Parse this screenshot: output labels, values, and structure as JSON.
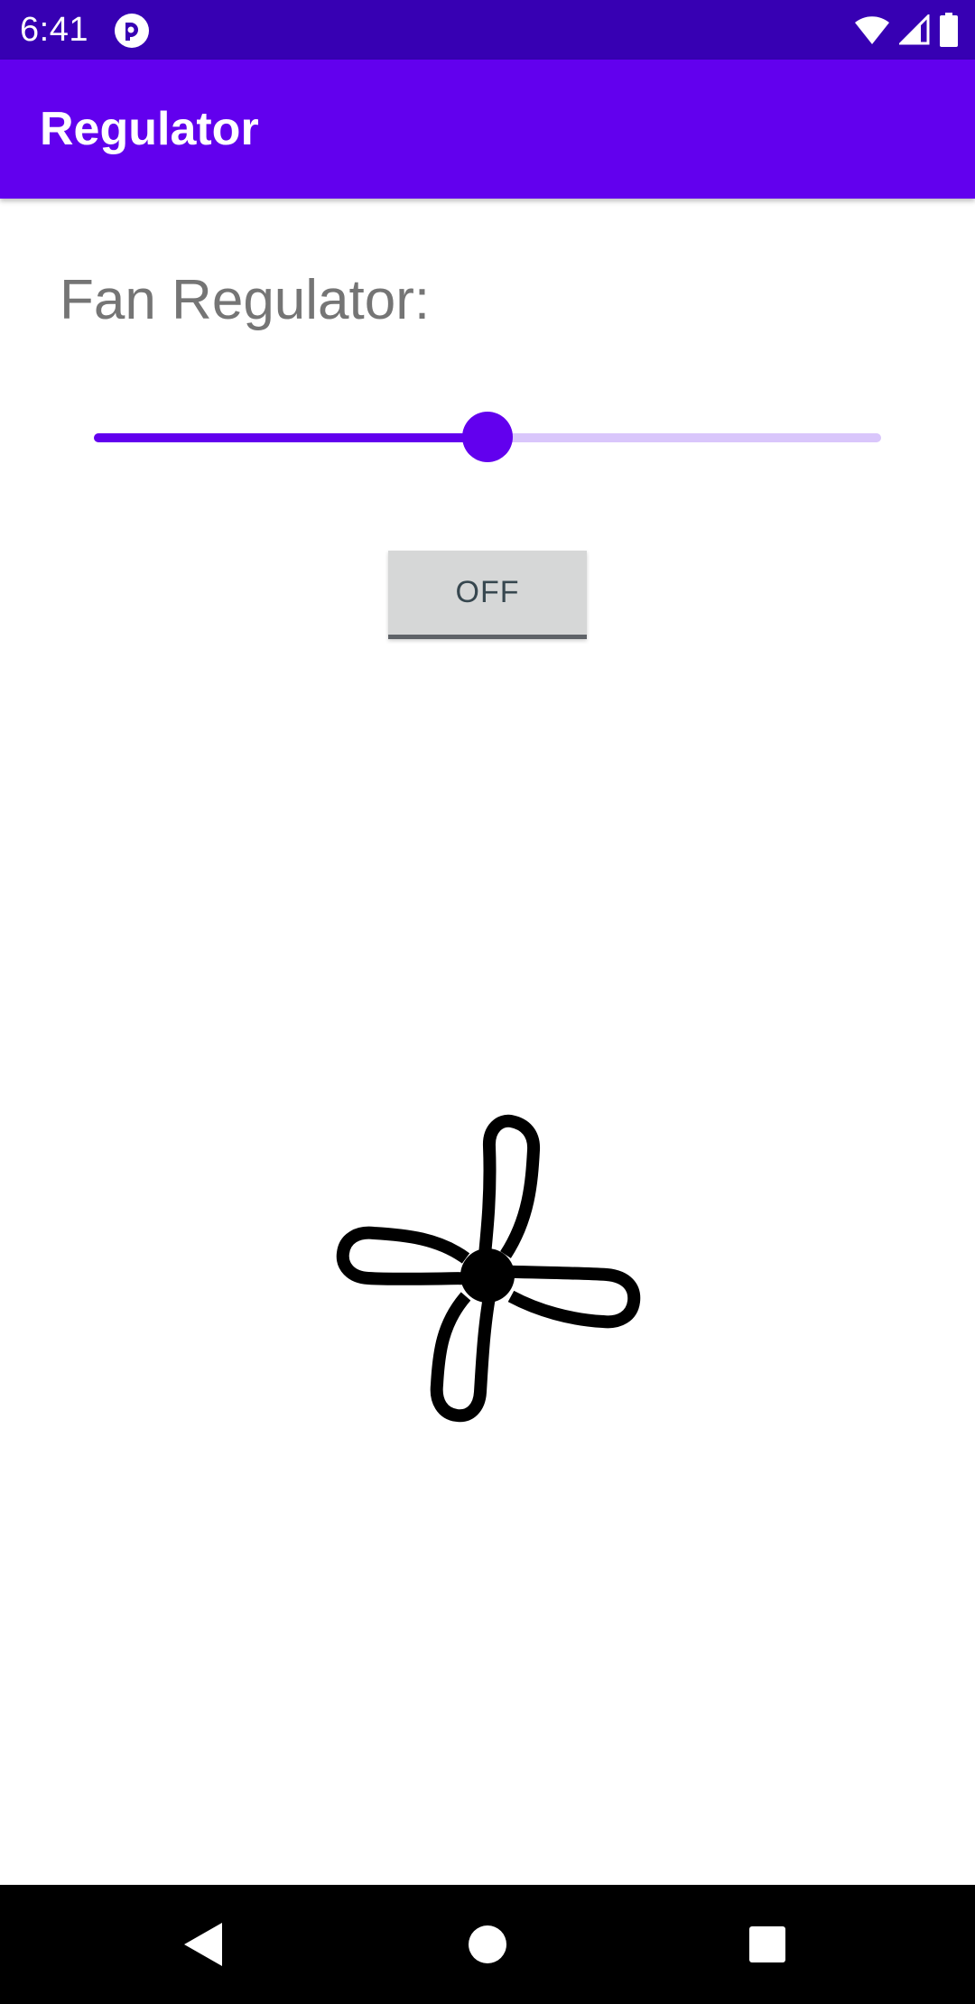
{
  "status_bar": {
    "time": "6:41",
    "app_icon": "pocket-casts-icon",
    "wifi_icon": "wifi-icon",
    "signal_icon": "cell-signal-icon",
    "battery_icon": "battery-icon"
  },
  "app_bar": {
    "title": "Regulator",
    "color": "#6200ee"
  },
  "main": {
    "heading": "Fan Regulator:",
    "slider": {
      "value_fraction": 0.5
    },
    "toggle_button_label": "OFF",
    "fan_icon": "fan-icon"
  },
  "nav_bar": {
    "back_icon": "back-triangle-icon",
    "home_icon": "home-circle-icon",
    "recents_icon": "recents-square-icon"
  },
  "colors": {
    "status_bar": "#3700b3",
    "accent": "#6200ee",
    "track_inactive": "#d9c6fb"
  }
}
